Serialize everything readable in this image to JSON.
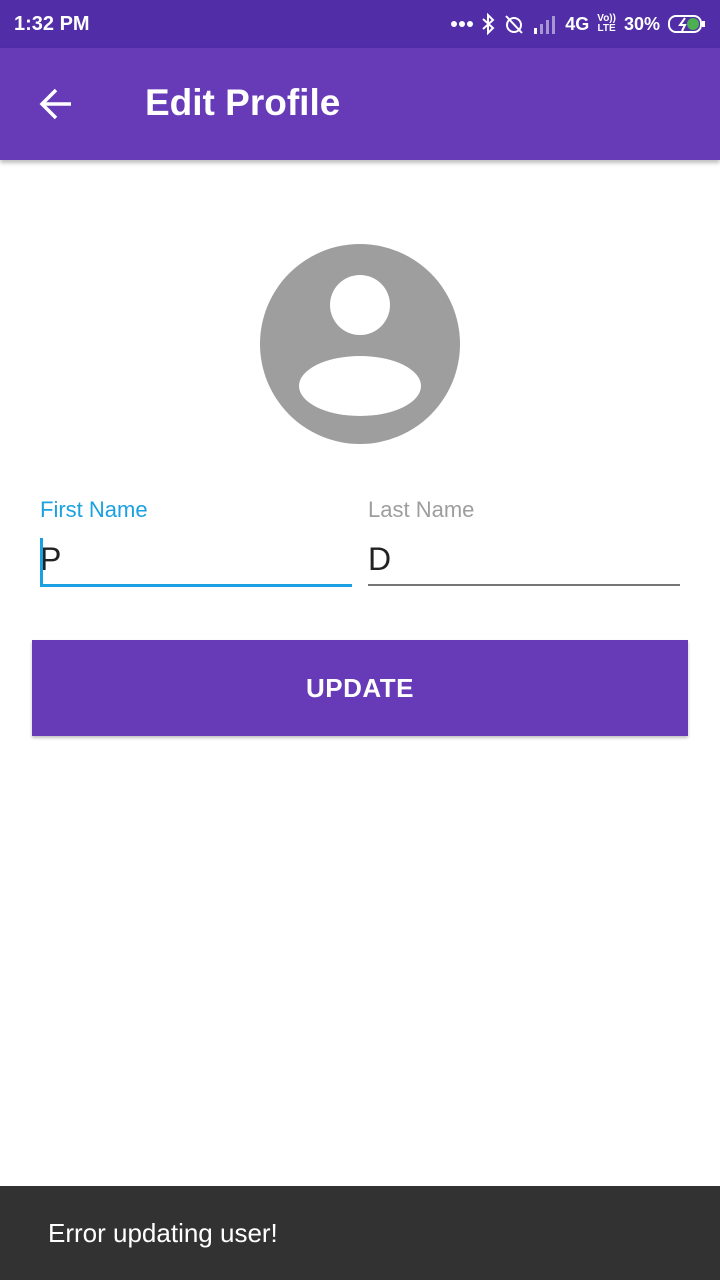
{
  "status_bar": {
    "time": "1:32 PM",
    "network": "4G",
    "volte_top": "Vo))",
    "volte_bottom": "LTE",
    "battery": "30%",
    "icons": [
      "more-dots-icon",
      "bluetooth-icon",
      "alarm-off-icon",
      "signal-icon",
      "battery-charging-icon"
    ]
  },
  "app_bar": {
    "title": "Edit Profile",
    "back_icon": "arrow-back-icon",
    "color": "#673ab7"
  },
  "avatar": {
    "icon": "account-circle-icon",
    "color": "#9e9e9e"
  },
  "form": {
    "first_name": {
      "label": "First Name",
      "value": "P",
      "focused": true,
      "accent": "#1ba1e2"
    },
    "last_name": {
      "label": "Last Name",
      "value": "D",
      "focused": false
    }
  },
  "update_button": {
    "label": "UPDATE"
  },
  "snackbar": {
    "message": "Error updating user!"
  }
}
